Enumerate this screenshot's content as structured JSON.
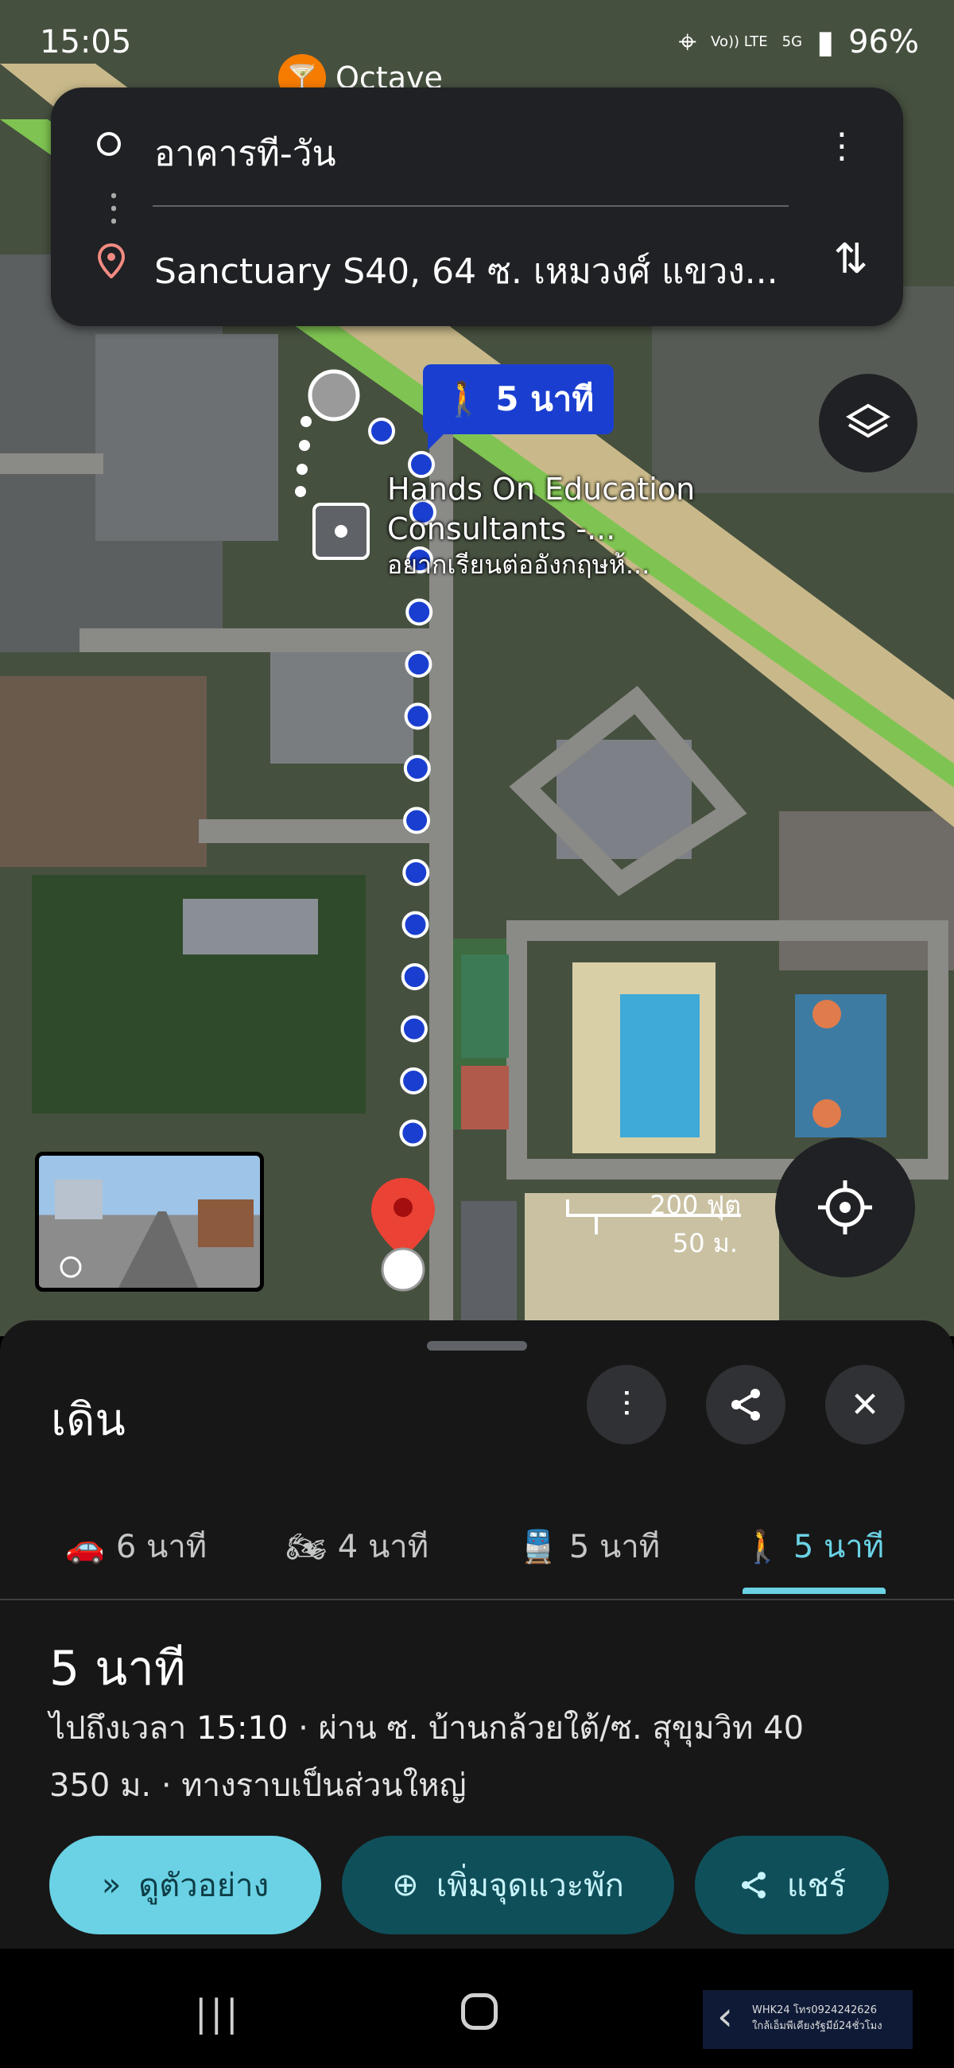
{
  "status_bar": {
    "time": "15:05",
    "sync_icon": "sync-icon",
    "volte_label": "Vo)) LTE",
    "signal_label": "5G",
    "battery": "96%"
  },
  "map": {
    "top_poi_name": "Octave",
    "walk_badge_text": "5 นาที",
    "poi_name": "Hands On Education",
    "poi_name_line2": "Consultants -...",
    "poi_subtitle": "อยากเรียนต่ออังกฤษห้...",
    "scale_ft": "200 ฟุต",
    "scale_m": "50 ม."
  },
  "directions": {
    "origin": "อาคารที-วัน",
    "destination": "Sanctuary S40, 64 ซ. เหมวงศ์ แขวง..."
  },
  "sheet": {
    "mode_title": "เดิน",
    "tabs": [
      {
        "icon": "car-icon",
        "label": "6 นาที"
      },
      {
        "icon": "motorcycle-icon",
        "label": "4 นาที"
      },
      {
        "icon": "train-icon",
        "label": "5 นาที"
      },
      {
        "icon": "walk-icon",
        "label": "5 นาที",
        "active": true
      }
    ],
    "duration": "5 นาที",
    "arrival_prefix": "ไปถึงเวลา",
    "arrival_time": "15:10",
    "via": "· ผ่าน ซ. บ้านกล้วยใต้/ซ. สุขุมวิท 40",
    "distance": "350 ม.",
    "terrain": "· ทางราบเป็นส่วนใหญ่",
    "btn_preview": "ดูตัวอย่าง",
    "btn_add_stop": "เพิ่มจุดแวะพัก",
    "btn_share": "แชร์"
  },
  "watermark": {
    "line1": "WHK24 โทร0924242626",
    "line2": "ใกล้เอ็มพีเคียงรัฐมีย์24ชั่วโมง"
  },
  "colors": {
    "route_dots": "#1a3fd0",
    "accent": "#6ad2e4",
    "dest_pin": "#ea4335",
    "sheet_bg": "#171717"
  }
}
